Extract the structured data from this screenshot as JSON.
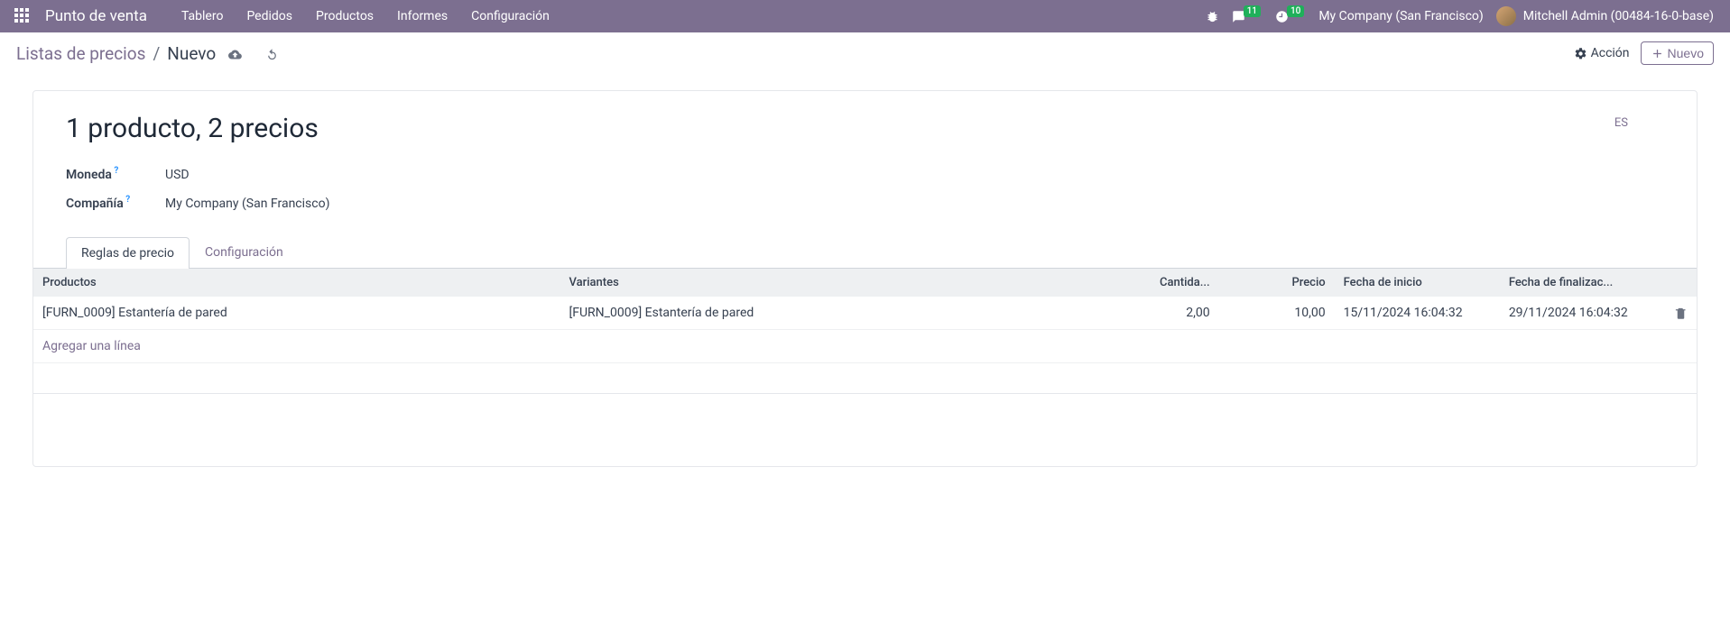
{
  "topnav": {
    "brand": "Punto de venta",
    "menu": [
      "Tablero",
      "Pedidos",
      "Productos",
      "Informes",
      "Configuración"
    ],
    "messages_count": "11",
    "activities_count": "10",
    "company": "My Company (San Francisco)",
    "user": "Mitchell Admin (00484-16-0-base)"
  },
  "breadcrumb": {
    "parent": "Listas de precios",
    "current": "Nuevo"
  },
  "actions": {
    "action_label": "Acción",
    "new_label": "Nuevo"
  },
  "record": {
    "title": "1 producto, 2 precios",
    "lang_badge": "ES",
    "currency_label": "Moneda",
    "currency_value": "USD",
    "company_label": "Compañía",
    "company_value": "My Company (San Francisco)"
  },
  "tabs": {
    "rules": "Reglas de precio",
    "config": "Configuración"
  },
  "table": {
    "headers": {
      "products": "Productos",
      "variants": "Variantes",
      "quantity": "Cantida...",
      "price": "Precio",
      "start": "Fecha de inicio",
      "end": "Fecha de finalizac..."
    },
    "rows": [
      {
        "product": "[FURN_0009] Estantería de pared",
        "variant": "[FURN_0009] Estantería de pared",
        "qty": "2,00",
        "price": "10,00",
        "start": "15/11/2024 16:04:32",
        "end": "29/11/2024 16:04:32"
      }
    ],
    "add_line": "Agregar una línea"
  }
}
